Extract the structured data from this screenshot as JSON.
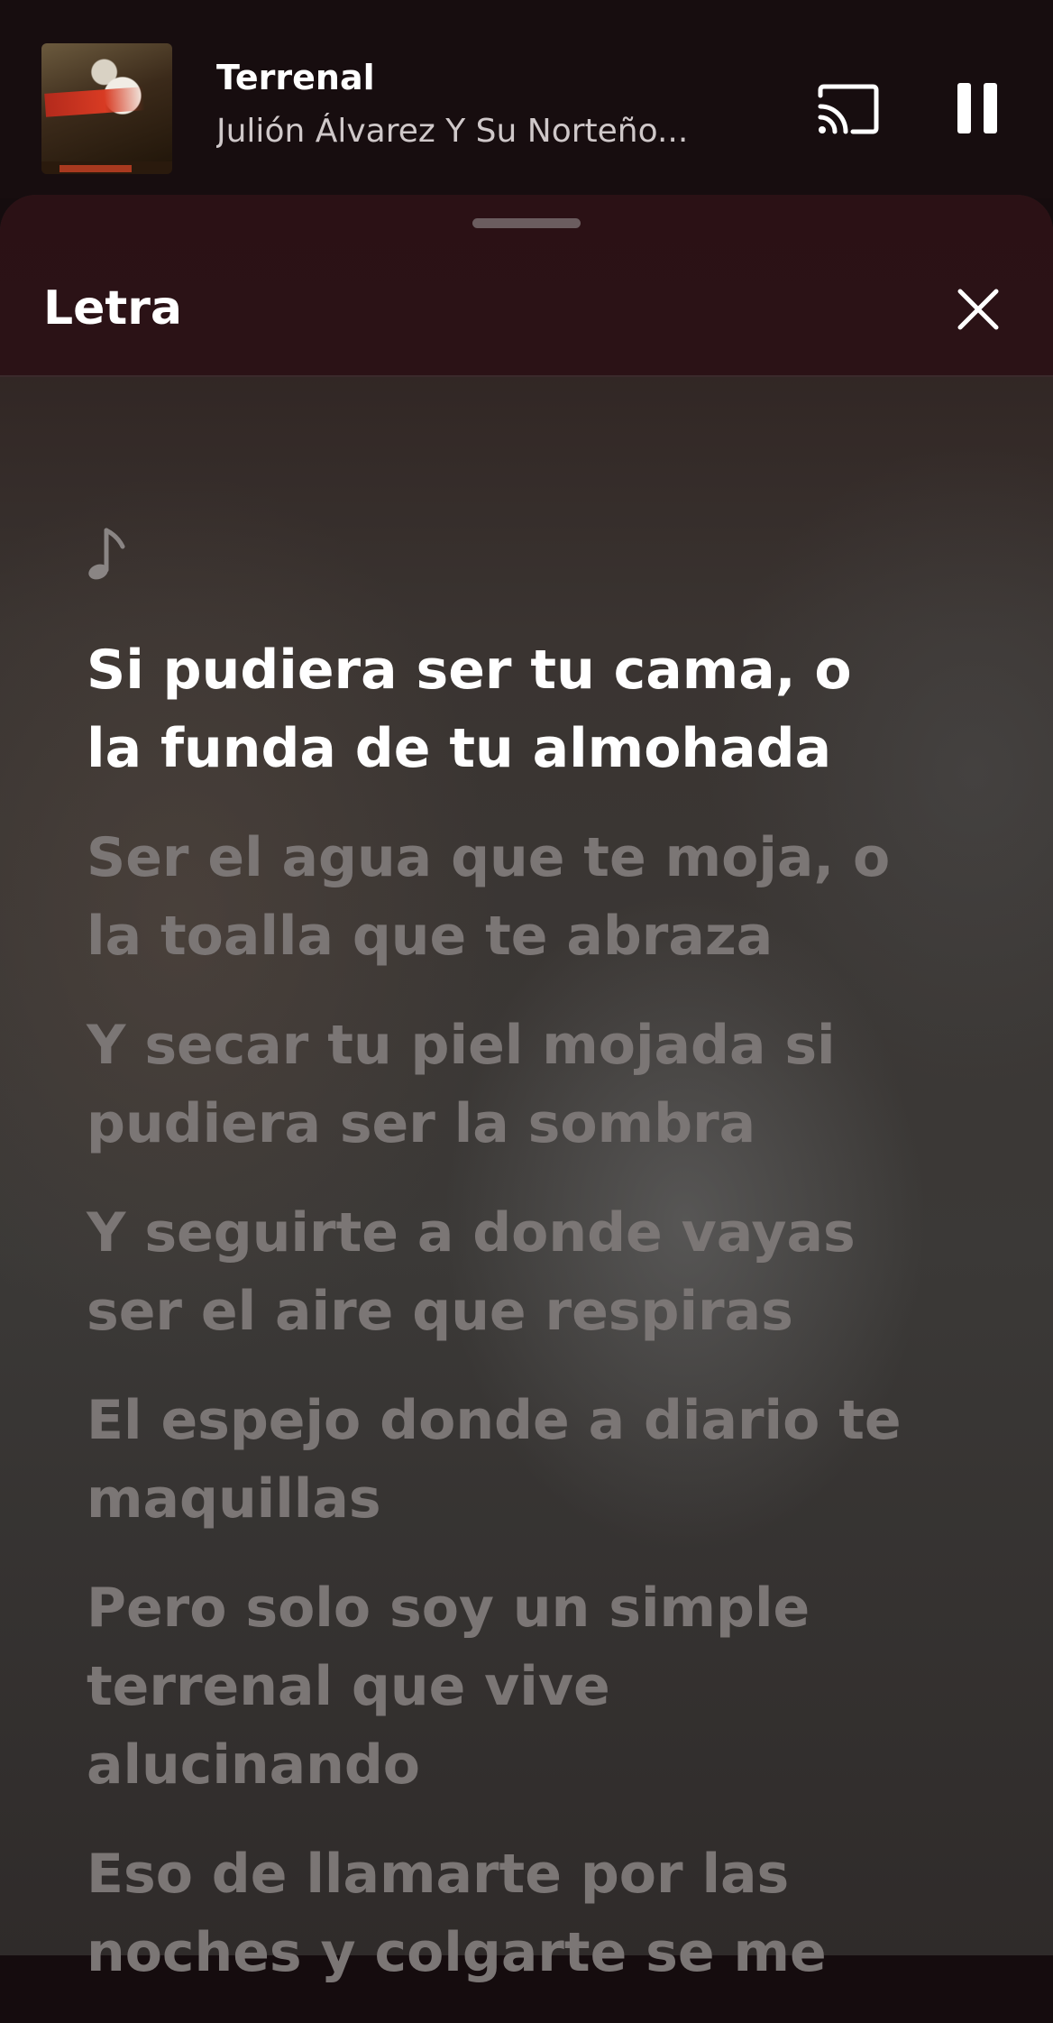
{
  "now_playing": {
    "title": "Terrenal",
    "artist": "Julión Álvarez Y Su Norteño..."
  },
  "sheet": {
    "title": "Letra"
  },
  "lyrics": [
    {
      "text": "Si pudiera ser tu cama, o la funda de tu almohada",
      "active": true
    },
    {
      "text": "Ser el agua que te moja, o la toalla que te abraza",
      "active": false
    },
    {
      "text": "Y secar tu piel mojada si pudiera ser la sombra",
      "active": false
    },
    {
      "text": "Y seguirte a donde vayas ser el aire que respiras",
      "active": false
    },
    {
      "text": "El espejo donde a diario te maquillas",
      "active": false
    },
    {
      "text": "Pero solo soy un simple terrenal que vive alucinando",
      "active": false
    },
    {
      "text": "Eso de llamarte por las noches y colgarte se me",
      "active": false
    }
  ],
  "icons": {
    "cast": "cast-icon",
    "pause": "pause-icon",
    "close": "close-icon",
    "music_note": "music-note-icon"
  },
  "colors": {
    "active_lyric": "#ffffff",
    "inactive_lyric": "#7b7675",
    "header_bg": "#2b1115"
  }
}
